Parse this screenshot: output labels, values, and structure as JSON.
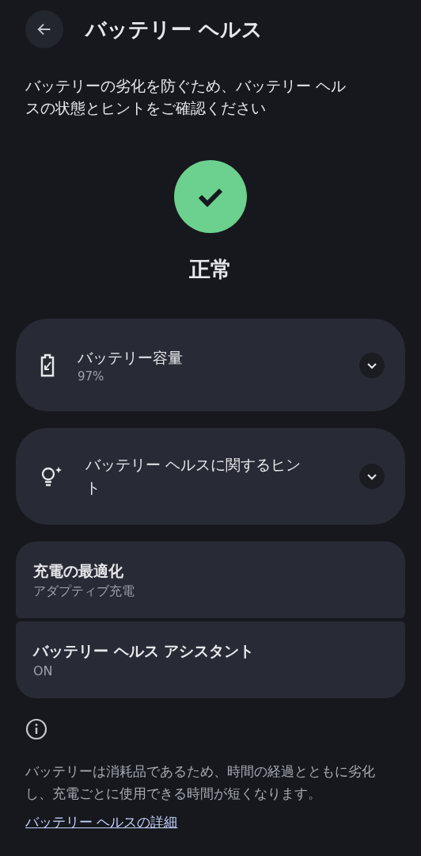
{
  "header": {
    "title": "バッテリー ヘルス"
  },
  "description": "バッテリーの劣化を防ぐため、バッテリー ヘルスの状態とヒントをご確認ください",
  "status": {
    "label": "正常"
  },
  "expandable_cards": [
    {
      "title": "バッテリー容量",
      "subtitle": "97%",
      "expanded": false
    },
    {
      "title": "バッテリー ヘルスに関するヒント",
      "expanded": false
    }
  ],
  "settings": [
    {
      "title": "充電の最適化",
      "subtitle": "アダプティブ充電"
    },
    {
      "title": "バッテリー ヘルス アシスタント",
      "subtitle": "ON"
    }
  ],
  "footer": {
    "text": "バッテリーは消耗品であるため、時間の経過とともに劣化し、充電ごとに使用できる時間が短くなります。",
    "link": "バッテリー ヘルスの詳細"
  }
}
